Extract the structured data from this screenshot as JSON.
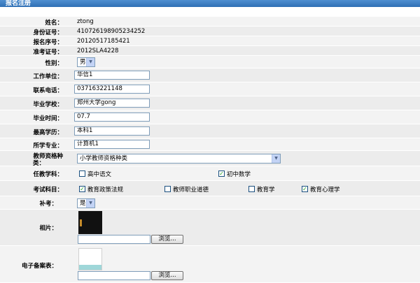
{
  "title": "报名注册",
  "fields": {
    "name": {
      "label": "姓名：",
      "value": "ztong"
    },
    "id_number": {
      "label": "身份证号：",
      "value": "410726198905234252"
    },
    "reg_number": {
      "label": "报名序号：",
      "value": "20120517185421"
    },
    "exam_number": {
      "label": "准考证号：",
      "value": "2012SLA4228"
    },
    "gender": {
      "label": "性别：",
      "value": "男"
    },
    "work_unit": {
      "label": "工作单位：",
      "value": "华信1"
    },
    "phone": {
      "label": "联系电话：",
      "value": "037163221148"
    },
    "school": {
      "label": "毕业学校：",
      "value": "郑州大学gong"
    },
    "grad_time": {
      "label": "毕业时间：",
      "value": "07.7"
    },
    "education": {
      "label": "最高学历：",
      "value": "本科1"
    },
    "major": {
      "label": "所学专业：",
      "value": "计算机1"
    },
    "cert_type": {
      "label_line1": "教师资格种",
      "label_line2": "类：",
      "value": "小学教师资格种类"
    },
    "subject": {
      "label": "任教学科：",
      "options": [
        {
          "label": "高中语文",
          "checked": false
        },
        {
          "label": "初中数学",
          "checked": true
        }
      ]
    },
    "exam_subjects": {
      "label": "考试科目：",
      "options": [
        {
          "label": "教育政策法规",
          "checked": true
        },
        {
          "label": "教师职业道德",
          "checked": false
        },
        {
          "label": "教育学",
          "checked": false
        },
        {
          "label": "教育心理学",
          "checked": true
        }
      ]
    },
    "retake": {
      "label": "补考：",
      "value": "是"
    },
    "photo": {
      "label": "相片：",
      "browse_label": "浏览..."
    },
    "record_form": {
      "label": "电子备案表：",
      "browse_label": "浏览..."
    }
  },
  "colors": {
    "title_bar": "#2f6fb5",
    "check": "#21a121",
    "input_border": "#7f9db9"
  }
}
